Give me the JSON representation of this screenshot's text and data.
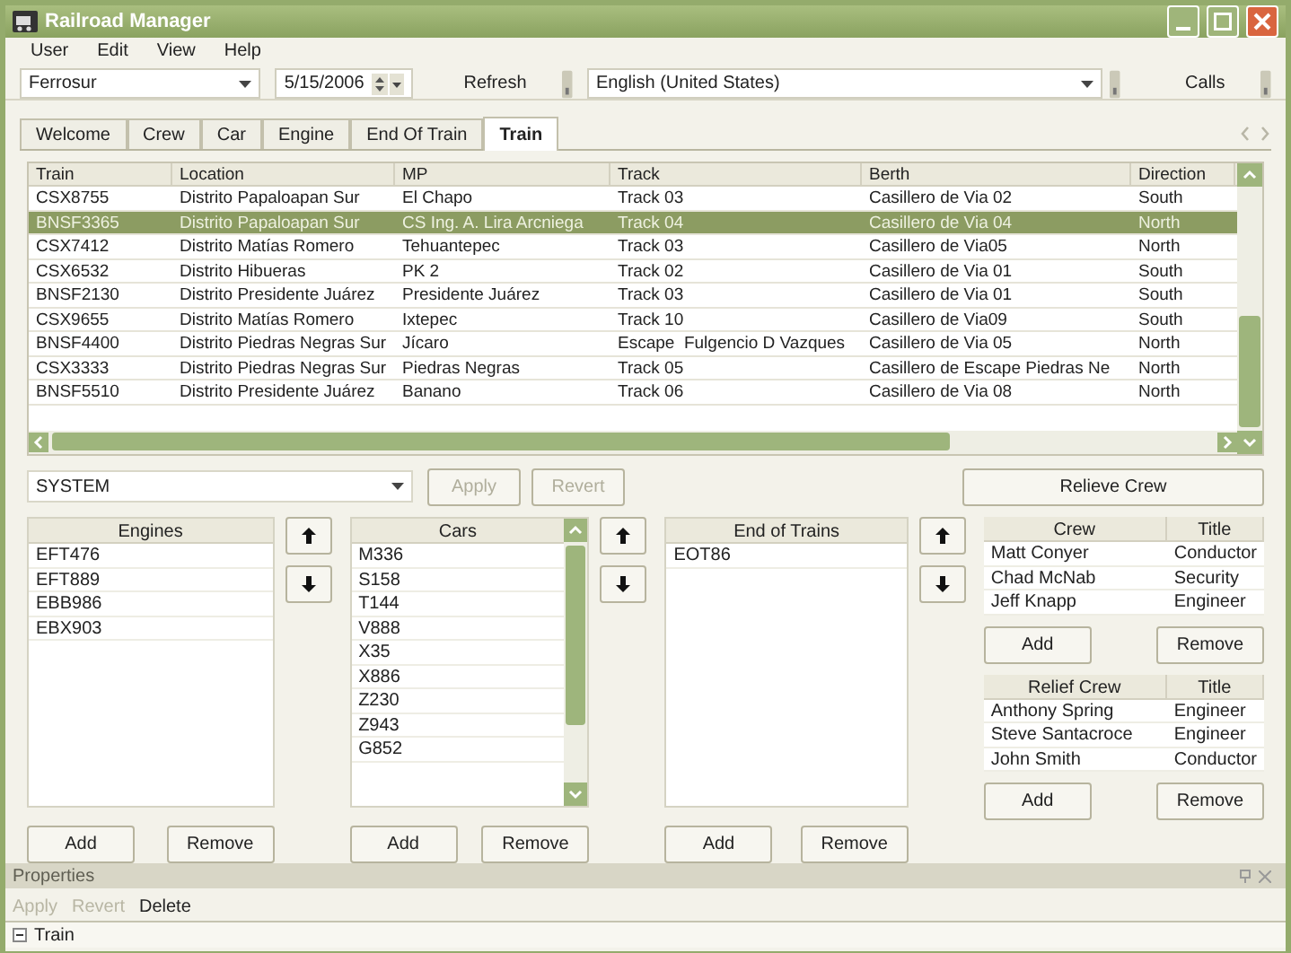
{
  "window": {
    "title": "Railroad Manager"
  },
  "menu": [
    "User",
    "Edit",
    "View",
    "Help"
  ],
  "toolbar": {
    "railroad": {
      "value": "Ferrosur"
    },
    "date": {
      "value": "5/15/2006"
    },
    "refresh": "Refresh",
    "language": {
      "value": "English (United States)"
    },
    "calls": "Calls"
  },
  "tabs": [
    {
      "label": "Welcome",
      "selected": false
    },
    {
      "label": "Crew",
      "selected": false
    },
    {
      "label": "Car",
      "selected": false
    },
    {
      "label": "Engine",
      "selected": false
    },
    {
      "label": "End Of Train",
      "selected": false
    },
    {
      "label": "Train",
      "selected": true
    }
  ],
  "grid": {
    "columns": [
      "Train",
      "Location",
      "MP",
      "Track",
      "Berth",
      "Direction"
    ],
    "rows": [
      {
        "cells": [
          "CSX8755",
          "Distrito Papaloapan Sur",
          "El Chapo",
          "Track 03",
          "Casillero de Via 02",
          "South"
        ],
        "selected": false
      },
      {
        "cells": [
          "BNSF3365",
          "Distrito Papaloapan Sur",
          "CS Ing. A. Lira Arcniega",
          "Track 04",
          "Casillero de Via 04",
          "North"
        ],
        "selected": true
      },
      {
        "cells": [
          "CSX7412",
          "Distrito Matías Romero",
          "Tehuantepec",
          "Track 03",
          "Casillero de Via05",
          "North"
        ],
        "selected": false
      },
      {
        "cells": [
          "CSX6532",
          "Distrito Hibueras",
          "PK 2",
          "Track 02",
          "Casillero de Via 01",
          "South"
        ],
        "selected": false
      },
      {
        "cells": [
          "BNSF2130",
          "Distrito Presidente Juárez",
          "Presidente Juárez",
          "Track 03",
          "Casillero de Via 01",
          "South"
        ],
        "selected": false
      },
      {
        "cells": [
          "CSX9655",
          "Distrito Matías Romero",
          "Ixtepec",
          "Track 10",
          "Casillero de Via09",
          "South"
        ],
        "selected": false
      },
      {
        "cells": [
          "BNSF4400",
          "Distrito Piedras Negras Sur",
          "Jícaro",
          "Escape  Fulgencio D Vazques",
          "Casillero de Via 05",
          "North"
        ],
        "selected": false
      },
      {
        "cells": [
          "CSX3333",
          "Distrito Piedras Negras Sur",
          "Piedras Negras",
          "Track 05",
          "Casillero de Escape Piedras Ne",
          "North"
        ],
        "selected": false
      },
      {
        "cells": [
          "BNSF5510",
          "Distrito Presidente Juárez",
          "Banano",
          "Track 06",
          "Casillero de Via 08",
          "North"
        ],
        "selected": false
      }
    ]
  },
  "user_combo": {
    "value": "SYSTEM"
  },
  "apply_button": {
    "label": "Apply",
    "disabled": true
  },
  "revert_button": {
    "label": "Revert",
    "disabled": true
  },
  "relieve_button": "Relieve Crew",
  "engines": {
    "header": "Engines",
    "items": [
      "EFT476",
      "EFT889",
      "EBB986",
      "EBX903"
    ],
    "add": "Add",
    "remove": "Remove"
  },
  "cars": {
    "header": "Cars",
    "items": [
      "M336",
      "S158",
      "T144",
      "V888",
      "X35",
      "X886",
      "Z230",
      "Z943",
      "G852"
    ],
    "add": "Add",
    "remove": "Remove"
  },
  "end_of_trains": {
    "header": "End of Trains",
    "items": [
      "EOT86"
    ],
    "add": "Add",
    "remove": "Remove"
  },
  "crew": {
    "columns": [
      "Crew",
      "Title"
    ],
    "rows": [
      [
        "Matt Conyer",
        "Conductor"
      ],
      [
        "Chad McNab",
        "Security"
      ],
      [
        "Jeff Knapp",
        "Engineer"
      ]
    ],
    "add": "Add",
    "remove": "Remove"
  },
  "relief_crew": {
    "columns": [
      "Relief Crew",
      "Title"
    ],
    "rows": [
      [
        "Anthony Spring",
        "Engineer"
      ],
      [
        "Steve Santacroce",
        "Engineer"
      ],
      [
        "John Smith",
        "Conductor"
      ]
    ],
    "add": "Add",
    "remove": "Remove"
  },
  "properties": {
    "title": "Properties",
    "actions": [
      {
        "label": "Apply",
        "disabled": true
      },
      {
        "label": "Revert",
        "disabled": true
      },
      {
        "label": "Delete",
        "disabled": false
      }
    ],
    "tree": [
      {
        "label": "Train",
        "expanded": true
      }
    ]
  }
}
